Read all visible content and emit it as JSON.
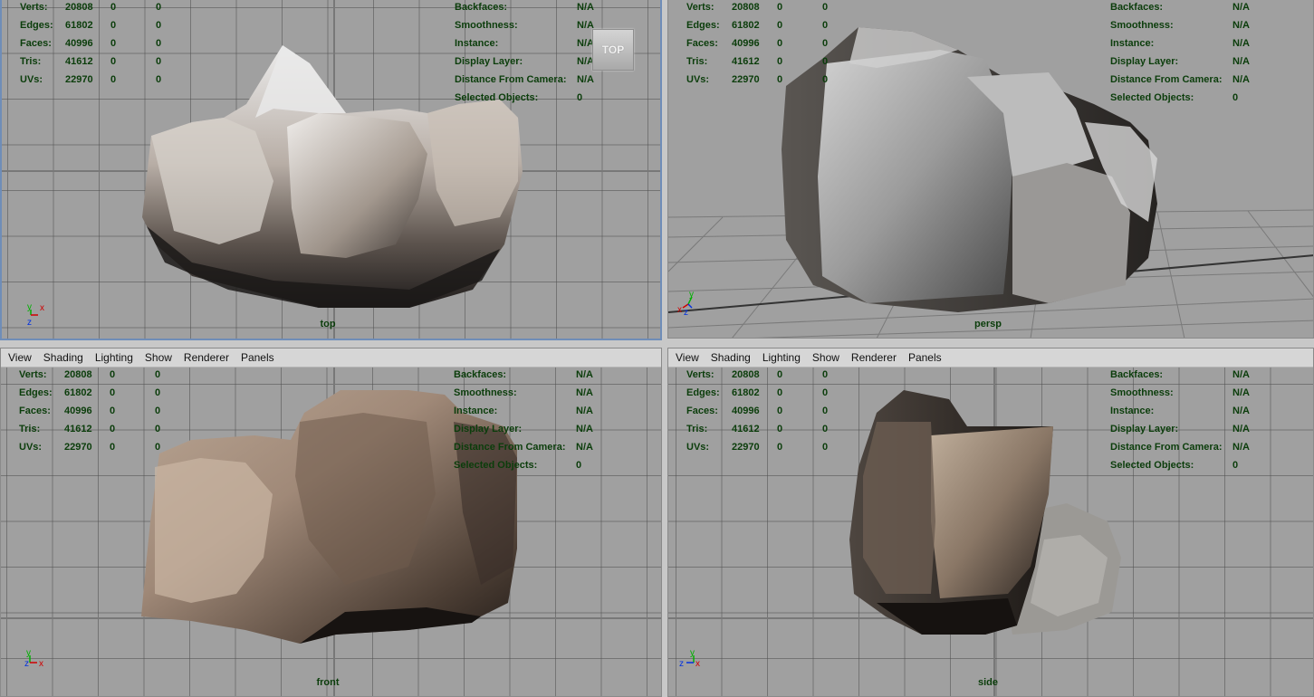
{
  "menu": [
    "View",
    "Shading",
    "Lighting",
    "Show",
    "Renderer",
    "Panels"
  ],
  "stats": {
    "rows": [
      {
        "label": "Verts:",
        "values": [
          "20808",
          "0",
          "0"
        ]
      },
      {
        "label": "Edges:",
        "values": [
          "61802",
          "0",
          "0"
        ]
      },
      {
        "label": "Faces:",
        "values": [
          "40996",
          "0",
          "0"
        ]
      },
      {
        "label": "Tris:",
        "values": [
          "41612",
          "0",
          "0"
        ]
      },
      {
        "label": "UVs:",
        "values": [
          "22970",
          "0",
          "0"
        ]
      }
    ],
    "right_rows": [
      {
        "label": "Backfaces:",
        "value": "N/A"
      },
      {
        "label": "Smoothness:",
        "value": "N/A"
      },
      {
        "label": "Instance:",
        "value": "N/A"
      },
      {
        "label": "Display Layer:",
        "value": "N/A"
      },
      {
        "label": "Distance From Camera:",
        "value": "N/A"
      },
      {
        "label": "Selected Objects:",
        "value": "0"
      }
    ]
  },
  "viewports": {
    "top": {
      "label": "top",
      "viewcube": "TOP"
    },
    "persp": {
      "label": "persp"
    },
    "front": {
      "label": "front"
    },
    "side": {
      "label": "side"
    }
  },
  "axes": {
    "x": "x",
    "y": "y",
    "z": "z"
  },
  "colors": {
    "viewport_bg": "#a0a0a0",
    "hud_text": "#0b3d0b",
    "active_border": "#6f8db8",
    "axis_x": "#d00000",
    "axis_y": "#00b000",
    "axis_z": "#0030e0"
  }
}
